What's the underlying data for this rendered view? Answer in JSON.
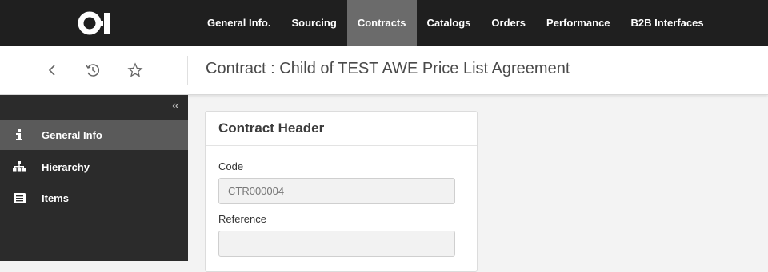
{
  "brand": {
    "logo_icon": "oi-logo-icon"
  },
  "nav": {
    "items": [
      {
        "label": "General Info."
      },
      {
        "label": "Sourcing"
      },
      {
        "label": "Contracts",
        "active": true
      },
      {
        "label": "Catalogs"
      },
      {
        "label": "Orders"
      },
      {
        "label": "Performance"
      },
      {
        "label": "B2B Interfaces"
      }
    ]
  },
  "header": {
    "icons": [
      "back-icon",
      "history-icon",
      "favorite-star-icon"
    ],
    "title": "Contract : Child of TEST AWE Price List Agreement"
  },
  "sidebar": {
    "collapse_glyph": "«",
    "items": [
      {
        "label": "General Info",
        "icon": "info-icon",
        "active": true
      },
      {
        "label": "Hierarchy",
        "icon": "hierarchy-icon"
      },
      {
        "label": "Items",
        "icon": "list-icon"
      }
    ]
  },
  "card": {
    "title": "Contract Header",
    "fields": [
      {
        "label": "Code",
        "value": "CTR000004"
      },
      {
        "label": "Reference",
        "value": ""
      }
    ]
  },
  "colors": {
    "topbar": "#1f1f1f",
    "nav_active": "#6b6b6b",
    "sidebar": "#2b2b2b",
    "sidebar_active": "#5a5a5a"
  }
}
